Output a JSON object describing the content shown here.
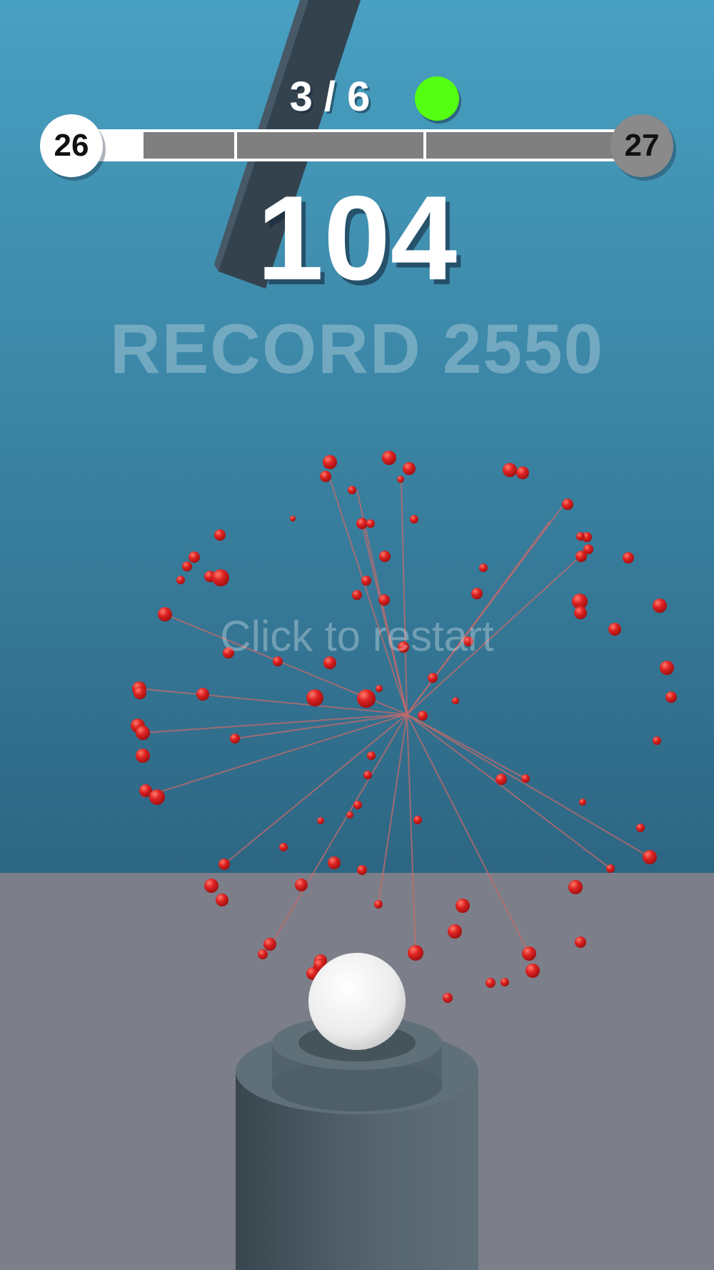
{
  "hud": {
    "stage_counter": "3 / 6",
    "stage_dot_color": "#55ff11",
    "current_level": "26",
    "next_level": "27",
    "level_progress": 0.12,
    "progress_segments": 4,
    "score": "104",
    "record": "RECORD 2550",
    "restart_prompt": "Click to restart"
  },
  "colors": {
    "sky_top": "#48a0c2",
    "sky_bottom": "#2d6683",
    "floor": "#7c7f89",
    "shard": "#d42020",
    "ball": "#f4f4f4",
    "pillar": "#4e5f6a",
    "beam": "#34424e"
  },
  "scene": {
    "objects": [
      "white-ball",
      "pillar-icon",
      "beam",
      "red-shard-explosion"
    ]
  }
}
